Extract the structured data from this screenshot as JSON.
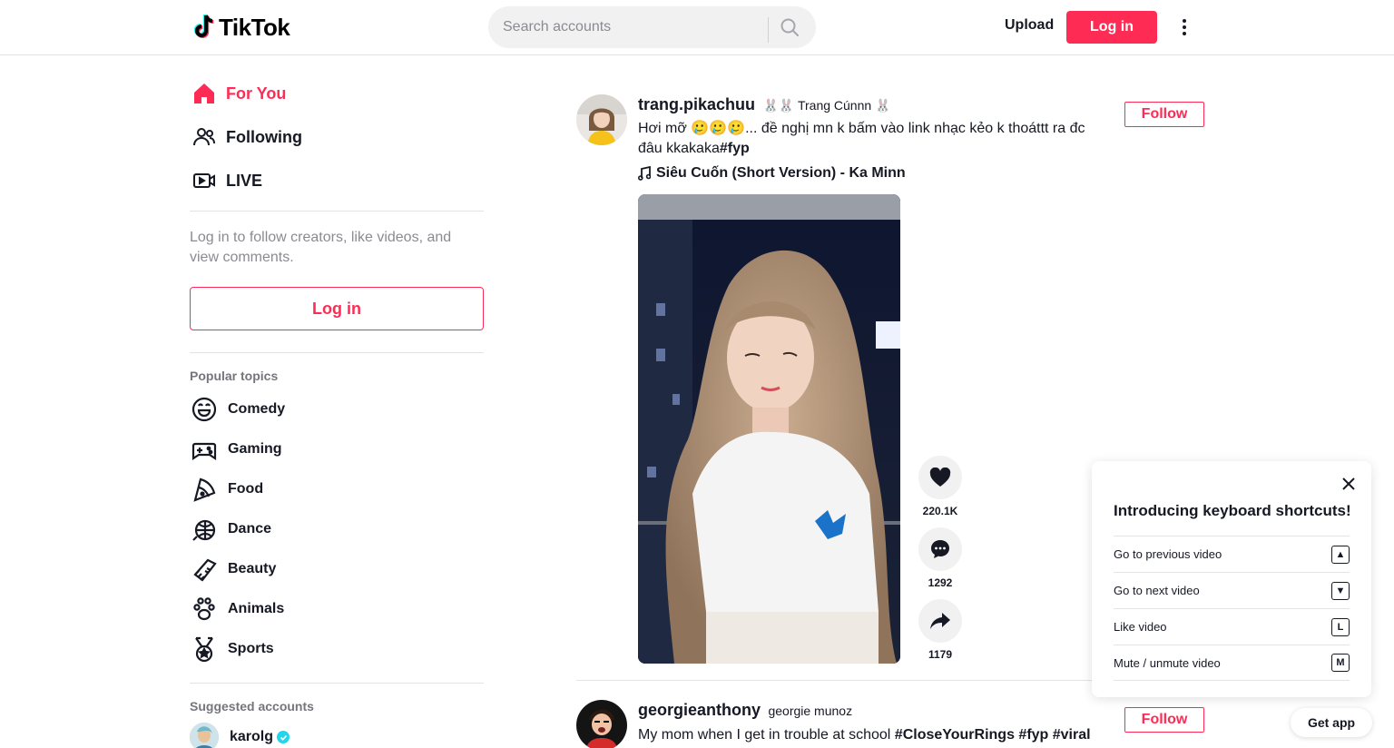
{
  "brand": {
    "name": "TikTok",
    "accent": "#fe2c55"
  },
  "header": {
    "search_placeholder": "Search accounts",
    "upload_label": "Upload",
    "login_label": "Log in"
  },
  "sidebar": {
    "nav": [
      {
        "label": "For You",
        "icon": "home-icon",
        "active": true
      },
      {
        "label": "Following",
        "icon": "following-icon",
        "active": false
      },
      {
        "label": "LIVE",
        "icon": "live-icon",
        "active": false
      }
    ],
    "login_hint": "Log in to follow creators, like videos, and view comments.",
    "login_label": "Log in",
    "popular_topics_title": "Popular topics",
    "topics": [
      {
        "label": "Comedy",
        "icon": "comedy-icon"
      },
      {
        "label": "Gaming",
        "icon": "gaming-icon"
      },
      {
        "label": "Food",
        "icon": "food-icon"
      },
      {
        "label": "Dance",
        "icon": "dance-icon"
      },
      {
        "label": "Beauty",
        "icon": "beauty-icon"
      },
      {
        "label": "Animals",
        "icon": "animals-icon"
      },
      {
        "label": "Sports",
        "icon": "sports-icon"
      }
    ],
    "suggested_title": "Suggested accounts",
    "suggested": [
      {
        "name": "karolg",
        "verified": true
      }
    ]
  },
  "feed": [
    {
      "author_id": "trang.pikachuu",
      "nickname": "🐰🐰 Trang Cúnnn 🐰",
      "caption": "Hơi mỡ 🥲🥲🥲... đề nghị mn k bấm vào link nhạc kẻo k thoáttt ra đc đâu kkakaka",
      "hashtags": "#fyp",
      "music": "Siêu Cuốn (Short Version) - Ka Minn",
      "follow_label": "Follow",
      "likes": "220.1K",
      "comments": "1292",
      "shares": "1179"
    },
    {
      "author_id": "georgieanthony",
      "nickname": "georgie munoz",
      "caption": "My mom when I get in trouble at school ",
      "hashtags": "#CloseYourRings #fyp #viral",
      "follow_label": "Follow"
    }
  ],
  "shortcuts": {
    "title": "Introducing keyboard shortcuts!",
    "items": [
      {
        "label": "Go to previous video",
        "key": "▲"
      },
      {
        "label": "Go to next video",
        "key": "▼"
      },
      {
        "label": "Like video",
        "key": "L"
      },
      {
        "label": "Mute / unmute video",
        "key": "M"
      }
    ]
  },
  "get_app_label": "Get app"
}
